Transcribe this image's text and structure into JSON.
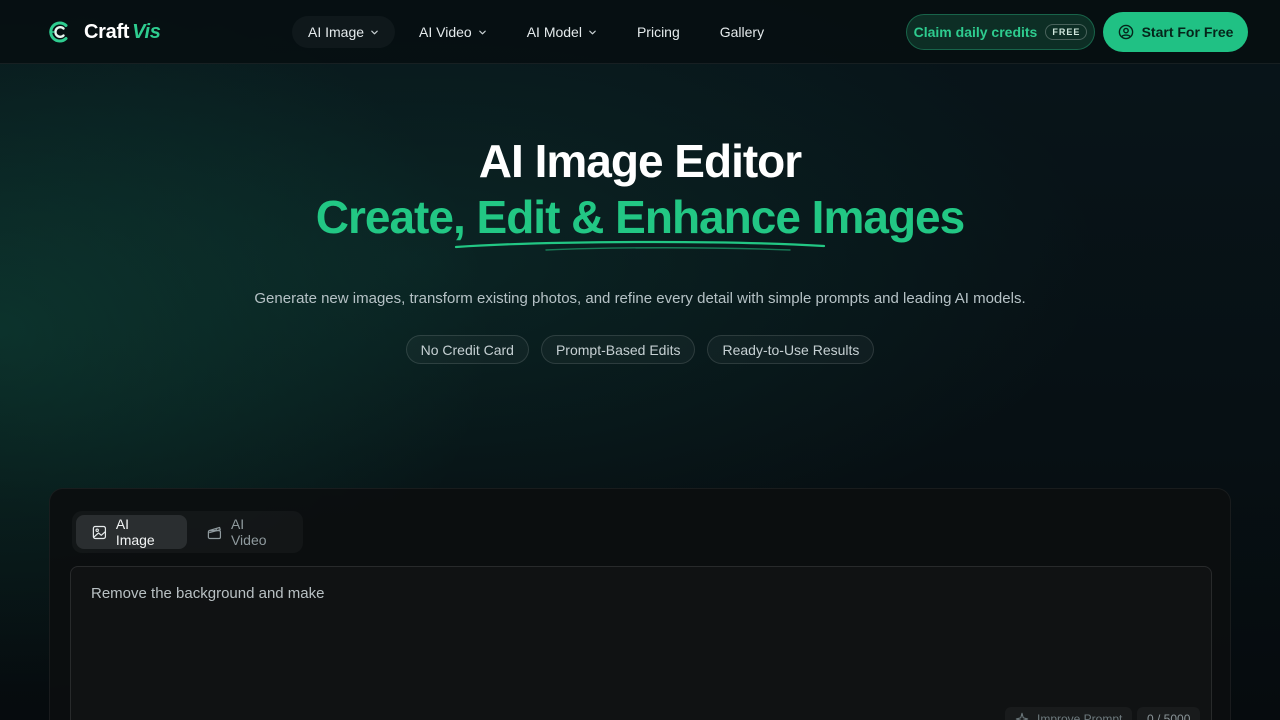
{
  "brand": {
    "name": "Craft",
    "accent": "Vis",
    "accent_color": "#2ecc8f"
  },
  "nav": {
    "items": [
      {
        "label": "AI Image",
        "dropdown": true
      },
      {
        "label": "AI Video",
        "dropdown": true
      },
      {
        "label": "AI Model",
        "dropdown": true
      },
      {
        "label": "Pricing",
        "dropdown": false
      },
      {
        "label": "Gallery",
        "dropdown": false
      }
    ]
  },
  "header": {
    "claim_label": "Claim daily credits",
    "claim_badge": "FREE",
    "start_label": "Start For Free",
    "start_icon": "user-circle-icon"
  },
  "hero": {
    "title": "AI Image Editor",
    "subtitle": "Create, Edit & Enhance Images",
    "description": "Generate new images, transform existing photos, and refine every detail with simple prompts and leading AI models.",
    "pills": [
      "No Credit Card",
      "Prompt-Based Edits",
      "Ready-to-Use Results"
    ]
  },
  "editor": {
    "tabs": [
      {
        "label": "AI Image",
        "icon": "image-icon",
        "active": true
      },
      {
        "label": "AI Video",
        "icon": "clapperboard-icon",
        "active": false
      }
    ],
    "prompt_value": "Remove the background and make",
    "improve_label": "Improve Prompt",
    "counter": "0 / 5000"
  },
  "colors": {
    "accent": "#22c784",
    "button_bg": "#20c184",
    "background": "#070d10"
  }
}
